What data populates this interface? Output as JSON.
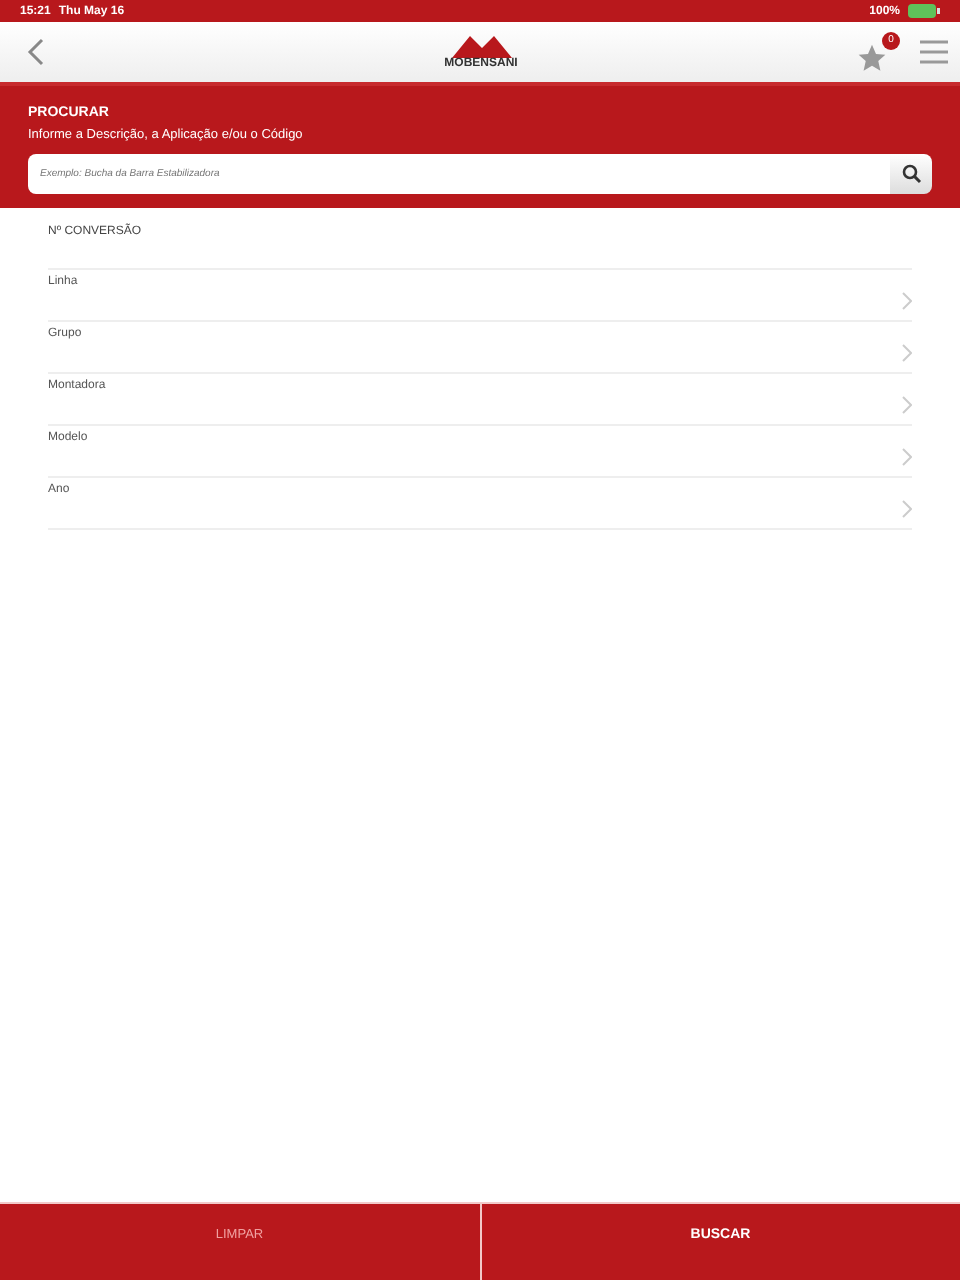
{
  "status_bar": {
    "time": "15:21",
    "date": "Thu May 16",
    "battery": "100%"
  },
  "header": {
    "logo": "MOBENSANI",
    "favorites_count": "0"
  },
  "search": {
    "title": "PROCURAR",
    "subtitle": "Informe a Descrição, a Aplicação e/ou o Código",
    "placeholder": "Exemplo: Bucha da Barra Estabilizadora"
  },
  "conversion_label": "Nº CONVERSÃO",
  "filters": [
    {
      "label": "Linha"
    },
    {
      "label": "Grupo"
    },
    {
      "label": "Montadora"
    },
    {
      "label": "Modelo"
    },
    {
      "label": "Ano"
    }
  ],
  "footer_buttons": [
    {
      "label": "LIMPAR",
      "disabled": true
    },
    {
      "label": "BUSCAR",
      "disabled": false
    }
  ]
}
